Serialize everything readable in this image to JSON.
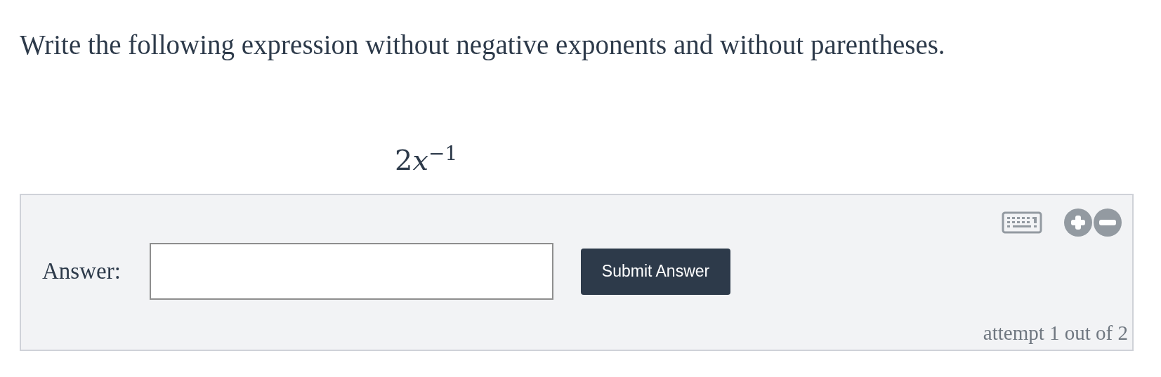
{
  "question": {
    "instruction": "Write the following expression without negative exponents and without parentheses.",
    "expression": {
      "coefficient": "2",
      "variable": "x",
      "exponent": "−1"
    }
  },
  "answer_panel": {
    "label": "Answer:",
    "submit_button": "Submit Answer",
    "attempt": "attempt 1 out of 2"
  }
}
